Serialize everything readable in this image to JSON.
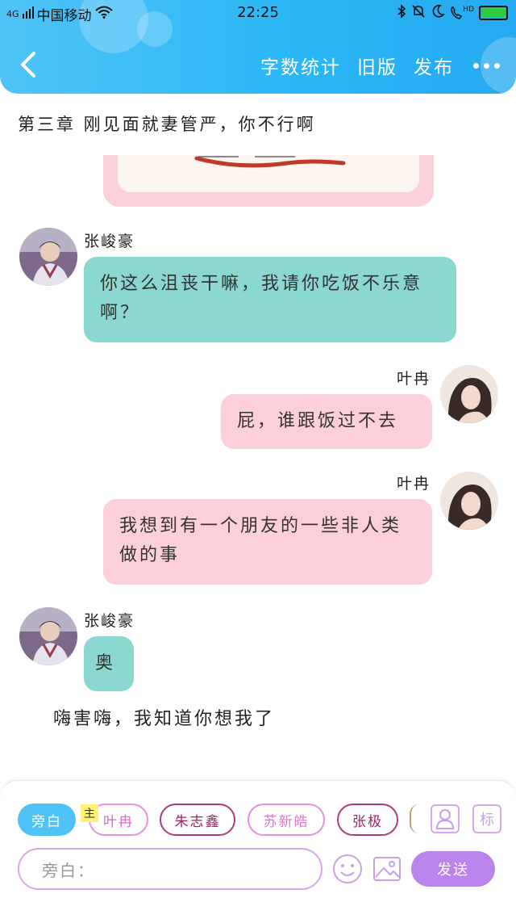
{
  "status_bar": {
    "network": "4G",
    "carrier": "中国移动",
    "time": "22:25",
    "hd": "HD"
  },
  "header": {
    "actions": {
      "word_count": "字数统计",
      "old_version": "旧版",
      "publish": "发布"
    }
  },
  "chapter": {
    "title": "第三章 刚见面就妻管严，你不行啊"
  },
  "messages": [
    {
      "speaker": "张峻豪",
      "side": "left",
      "text": "你这么沮丧干嘛，我请你吃饭不乐意啊？"
    },
    {
      "speaker": "叶冉",
      "side": "right",
      "text": "屁，谁跟饭过不去"
    },
    {
      "speaker": "叶冉",
      "side": "right",
      "text": "我想到有一个朋友的一些非人类做的事"
    },
    {
      "speaker": "张峻豪",
      "side": "left",
      "text": "奥"
    }
  ],
  "narration": "嗨害嗨，我知道你想我了",
  "composer": {
    "roles": [
      "旁白",
      "叶冉",
      "朱志鑫",
      "苏新皓",
      "张极"
    ],
    "main_badge": "主",
    "tag_icon_label": "标",
    "input_placeholder": "旁白：",
    "send_label": "发送"
  },
  "colors": {
    "header_blue": "#29b6f6",
    "left_bubble": "#8ad8cf",
    "right_bubble": "#fcd0da",
    "send_button": "#b985ea"
  }
}
